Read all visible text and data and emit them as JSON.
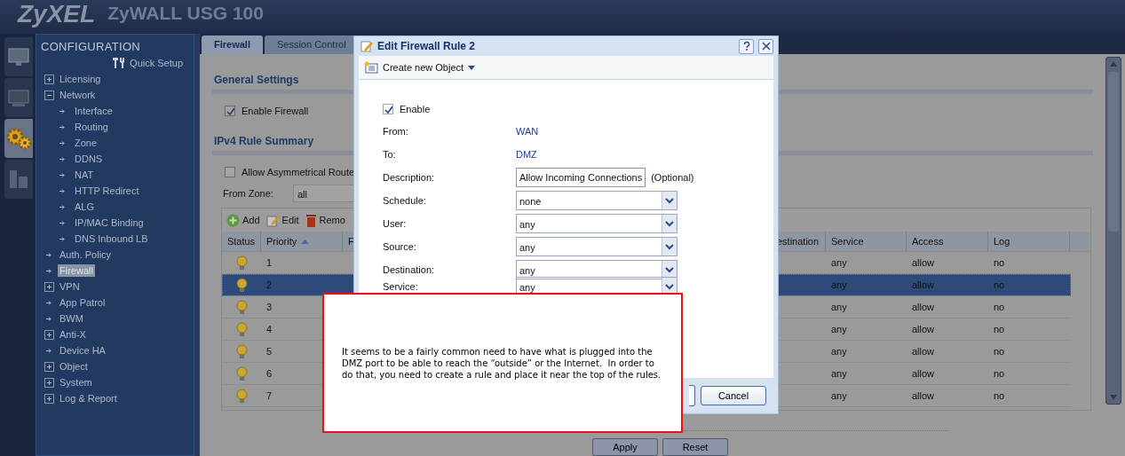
{
  "header": {
    "brand": "ZyXEL",
    "product": "ZyWALL USG 100"
  },
  "icon_tabs": [
    {
      "kind": "dashboard",
      "selected": false
    },
    {
      "kind": "monitor",
      "selected": false
    },
    {
      "kind": "configuration",
      "selected": true
    },
    {
      "kind": "maintenance",
      "selected": false
    }
  ],
  "sidebar": {
    "title": "CONFIGURATION",
    "quick_setup": "Quick Setup",
    "items": [
      {
        "label": "Licensing",
        "kind": "group",
        "expanded": false,
        "selected": false
      },
      {
        "label": "Network",
        "kind": "group",
        "expanded": true,
        "selected": false,
        "children": [
          {
            "label": "Interface",
            "kind": "leaf",
            "selected": false
          },
          {
            "label": "Routing",
            "kind": "leaf",
            "selected": false
          },
          {
            "label": "Zone",
            "kind": "leaf",
            "selected": false
          },
          {
            "label": "DDNS",
            "kind": "leaf",
            "selected": false
          },
          {
            "label": "NAT",
            "kind": "leaf",
            "selected": false
          },
          {
            "label": "HTTP Redirect",
            "kind": "leaf",
            "selected": false
          },
          {
            "label": "ALG",
            "kind": "leaf",
            "selected": false
          },
          {
            "label": "IP/MAC Binding",
            "kind": "leaf",
            "selected": false
          },
          {
            "label": "DNS Inbound LB",
            "kind": "leaf",
            "selected": false
          }
        ]
      },
      {
        "label": "Auth. Policy",
        "kind": "leaf",
        "selected": false
      },
      {
        "label": "Firewall",
        "kind": "leaf",
        "selected": true
      },
      {
        "label": "VPN",
        "kind": "group",
        "expanded": false,
        "selected": false
      },
      {
        "label": "App Patrol",
        "kind": "leaf",
        "selected": false
      },
      {
        "label": "BWM",
        "kind": "leaf",
        "selected": false
      },
      {
        "label": "Anti-X",
        "kind": "group",
        "expanded": false,
        "selected": false
      },
      {
        "label": "Device HA",
        "kind": "leaf",
        "selected": false
      },
      {
        "label": "Object",
        "kind": "group",
        "expanded": false,
        "selected": false
      },
      {
        "label": "System",
        "kind": "group",
        "expanded": false,
        "selected": false
      },
      {
        "label": "Log & Report",
        "kind": "group",
        "expanded": false,
        "selected": false
      }
    ]
  },
  "tabs": [
    {
      "label": "Firewall",
      "selected": true
    },
    {
      "label": "Session Control",
      "selected": false
    }
  ],
  "general": {
    "title": "General Settings",
    "enable_firewall": {
      "label": "Enable Firewall",
      "checked": true
    }
  },
  "rules": {
    "title": "IPv4 Rule Summary",
    "asymmetrical": {
      "label": "Allow Asymmetrical Route",
      "checked": false
    },
    "from_zone": {
      "label": "From Zone:",
      "value": "all"
    },
    "toolbar": [
      "Add",
      "Edit",
      "Remo"
    ],
    "columns": [
      "Status",
      "Priority",
      "F",
      "estination",
      "Service",
      "Access",
      "Log"
    ],
    "rows": [
      {
        "priority": "1",
        "service": "any",
        "access": "allow",
        "log": "no",
        "selected": false
      },
      {
        "priority": "2",
        "service": "any",
        "access": "allow",
        "log": "no",
        "selected": true
      },
      {
        "priority": "3",
        "service": "any",
        "access": "allow",
        "log": "no",
        "selected": false
      },
      {
        "priority": "4",
        "service": "any",
        "access": "allow",
        "log": "no",
        "selected": false
      },
      {
        "priority": "5",
        "service": "any",
        "access": "allow",
        "log": "no",
        "selected": false
      },
      {
        "priority": "6",
        "service": "any",
        "access": "allow",
        "log": "no",
        "selected": false
      },
      {
        "priority": "7",
        "service": "any",
        "access": "allow",
        "log": "no",
        "selected": false
      }
    ]
  },
  "buttons": [
    "Apply",
    "Reset"
  ],
  "dialog": {
    "title": "Edit Firewall Rule 2",
    "toolbar": "Create new Object",
    "enable": {
      "label": "Enable",
      "checked": true
    },
    "fields": [
      {
        "label": "From:",
        "kind": "text",
        "value": "WAN"
      },
      {
        "label": "To:",
        "kind": "text",
        "value": "DMZ"
      },
      {
        "label": "Description:",
        "kind": "input",
        "value": "Allow Incoming Connections",
        "note": "(Optional)"
      },
      {
        "label": "Schedule:",
        "kind": "select",
        "value": "none"
      },
      {
        "label": "User:",
        "kind": "select",
        "value": "any"
      },
      {
        "label": "Source:",
        "kind": "select",
        "value": "any"
      },
      {
        "label": "Destination:",
        "kind": "select",
        "value": "any"
      },
      {
        "label": "Service:",
        "kind": "select",
        "value": "any"
      }
    ],
    "buttons": [
      "Cancel"
    ]
  },
  "callout": "It seems to be a fairly common need to have what is plugged into the DMZ port to be able to reach the “outside” or the Internet.  In order to do that, you need to create a rule and place it near the top of the rules."
}
